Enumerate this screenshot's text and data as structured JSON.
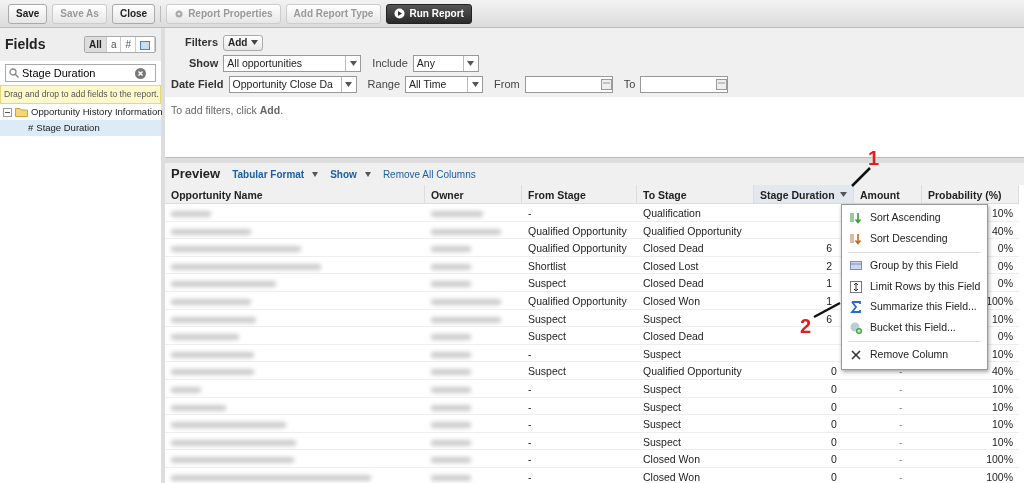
{
  "toolbar": {
    "buttons": [
      {
        "label": "Save",
        "disabled": false
      },
      {
        "label": "Save As",
        "disabled": true
      },
      {
        "label": "Close",
        "disabled": false
      },
      {
        "label": "Report Properties",
        "disabled": true,
        "kind": "icon"
      },
      {
        "label": "Add Report Type",
        "disabled": true
      },
      {
        "label": "Run Report",
        "disabled": false,
        "kind": "primary"
      }
    ]
  },
  "fields_panel": {
    "title": "Fields",
    "filters": [
      {
        "label": "All",
        "selected": true
      },
      {
        "label": "a",
        "selected": false
      },
      {
        "label": "#",
        "selected": false
      },
      {
        "kind": "date",
        "selected": false
      }
    ],
    "search": {
      "value": "Stage Duration"
    },
    "hint": "Drag and drop to add fields to the report.",
    "tree": [
      {
        "label": "Opportunity History Information",
        "expanded": true,
        "children": [
          {
            "label": "Stage Duration",
            "symbol": "#",
            "selected": true
          }
        ]
      }
    ]
  },
  "filters": {
    "label": "Filters",
    "add_button": "Add",
    "show_label": "Show",
    "show_value": "All opportunities",
    "include_label": "Include",
    "include_value": "Any",
    "date_field_label": "Date Field",
    "date_field_value": "Opportunity Close Da",
    "range_label": "Range",
    "range_value": "All Time",
    "from_label": "From",
    "to_label": "To",
    "empty_text": "To add filters, click **Add**."
  },
  "preview": {
    "title": "Preview",
    "links": [
      "Tabular Format",
      "Show",
      "Remove All Columns"
    ],
    "columns": [
      {
        "label": "Opportunity Name",
        "selected": false
      },
      {
        "label": "Owner",
        "selected": false
      },
      {
        "label": "From Stage",
        "selected": false
      },
      {
        "label": "To Stage",
        "selected": false
      },
      {
        "label": "Stage Duration",
        "selected": true
      },
      {
        "label": "Amount",
        "selected": false
      },
      {
        "label": "Probability (%)",
        "selected": false
      }
    ],
    "rows": [
      {
        "from": "-",
        "to": "Qualification",
        "probability": "10%"
      },
      {
        "from": "Qualified Opportunity",
        "to": "Qualified Opportunity",
        "probability": "40%"
      },
      {
        "from": "Qualified Opportunity",
        "to": "Closed Dead",
        "duration": "6",
        "probability": "0%"
      },
      {
        "from": "Shortlist",
        "to": "Closed Lost",
        "duration": "2",
        "probability": "0%"
      },
      {
        "from": "Suspect",
        "to": "Closed Dead",
        "duration": "1",
        "probability": "0%"
      },
      {
        "from": "Qualified Opportunity",
        "to": "Closed Won",
        "duration": "1",
        "probability": "100%"
      },
      {
        "from": "Suspect",
        "to": "Suspect",
        "duration": "6",
        "probability": "10%"
      },
      {
        "from": "Suspect",
        "to": "Closed Dead",
        "probability": "0%"
      },
      {
        "from": "-",
        "to": "Suspect",
        "probability": "10%"
      },
      {
        "from": "Suspect",
        "to": "Qualified Opportunity",
        "duration": "0",
        "amount": "-",
        "probability": "40%"
      },
      {
        "from": "-",
        "to": "Suspect",
        "duration": "0",
        "amount": "-",
        "probability": "10%"
      },
      {
        "from": "-",
        "to": "Suspect",
        "duration": "0",
        "amount": "-",
        "probability": "10%"
      },
      {
        "from": "-",
        "to": "Suspect",
        "duration": "0",
        "amount": "-",
        "probability": "10%"
      },
      {
        "from": "-",
        "to": "Suspect",
        "duration": "0",
        "amount": "-",
        "probability": "10%"
      },
      {
        "from": "-",
        "to": "Closed Won",
        "duration": "0",
        "amount": "-",
        "probability": "100%"
      },
      {
        "from": "-",
        "to": "Closed Won",
        "duration": "0",
        "amount": "-",
        "probability": "100%"
      }
    ]
  },
  "column_menu": {
    "items": [
      {
        "label": "Sort Ascending",
        "kind": "sort-asc"
      },
      {
        "label": "Sort Descending",
        "kind": "sort-desc"
      },
      {
        "kind": "divider"
      },
      {
        "label": "Group by this Field",
        "kind": "group"
      },
      {
        "label": "Limit Rows by this Field",
        "kind": "limit"
      },
      {
        "label": "Summarize this Field...",
        "kind": "sum"
      },
      {
        "label": "Bucket this Field...",
        "kind": "bucket"
      },
      {
        "kind": "divider"
      },
      {
        "label": "Remove Column",
        "kind": "remove"
      }
    ]
  },
  "annotations": [
    {
      "label": "1"
    },
    {
      "label": "2"
    }
  ]
}
